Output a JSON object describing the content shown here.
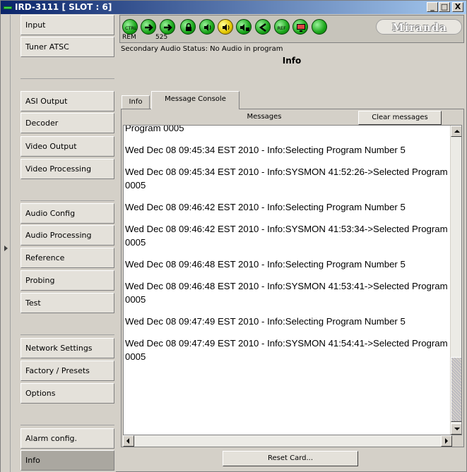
{
  "window": {
    "title": "IRD-3111 [ SLOT : 6]",
    "controls": {
      "minimize": "_",
      "maximize": "□",
      "close": "X"
    }
  },
  "sidebar": {
    "items": [
      {
        "label": "Input"
      },
      {
        "label": "Tuner ATSC"
      },
      {
        "label": "ASI Output"
      },
      {
        "label": "Decoder"
      },
      {
        "label": "Video Output"
      },
      {
        "label": "Video Processing"
      },
      {
        "label": "Audio Config"
      },
      {
        "label": "Audio Processing"
      },
      {
        "label": "Reference"
      },
      {
        "label": "Probing"
      },
      {
        "label": "Test"
      },
      {
        "label": "Network Settings"
      },
      {
        "label": "Factory / Presets"
      },
      {
        "label": "Options"
      },
      {
        "label": "Alarm config."
      },
      {
        "label": "Info"
      }
    ],
    "selected": "Info"
  },
  "toolbar": {
    "icons": [
      {
        "name": "ctrl-icon",
        "text": "CTRL",
        "label": "REM"
      },
      {
        "name": "arrow-right-icon",
        "label": "525"
      },
      {
        "name": "arrow-right-icon-2"
      },
      {
        "name": "lock-icon"
      },
      {
        "name": "audio-icon"
      },
      {
        "name": "audio-yellow-icon"
      },
      {
        "name": "audio-lock-icon"
      },
      {
        "name": "less-than-icon"
      },
      {
        "name": "ref-icon",
        "text": "REF"
      },
      {
        "name": "monitor-icon"
      },
      {
        "name": "status-light-icon"
      }
    ],
    "logo": "Miranda"
  },
  "status": {
    "secondary_audio": "Secondary Audio Status: No Audio in program"
  },
  "panel": {
    "title": "Info",
    "tabs": [
      {
        "label": "Info"
      },
      {
        "label": "Message Console"
      }
    ],
    "active_tab": "Message Console"
  },
  "console": {
    "header": "Messages",
    "clear_label": "Clear messages",
    "entries": [
      "Program 0005",
      "Wed Dec 08 09:45:34 EST 2010 - Info:Selecting Program Number 5",
      "Wed Dec 08 09:45:34 EST 2010 - Info:SYSMON 41:52:26->Selected Program 0005",
      "Wed Dec 08 09:46:42 EST 2010 - Info:Selecting Program Number 5",
      "Wed Dec 08 09:46:42 EST 2010 - Info:SYSMON 41:53:34->Selected Program 0005",
      "Wed Dec 08 09:46:48 EST 2010 - Info:Selecting Program Number 5",
      "Wed Dec 08 09:46:48 EST 2010 - Info:SYSMON 41:53:41->Selected Program 0005",
      "Wed Dec 08 09:47:49 EST 2010 - Info:Selecting Program Number 5",
      "Wed Dec 08 09:47:49 EST 2010 - Info:SYSMON 41:54:41->Selected Program 0005"
    ]
  },
  "footer": {
    "reset_label": "Reset Card..."
  },
  "colors": {
    "title_bar_start": "#0a246a",
    "title_bar_end": "#a6caf0",
    "icon_green": "#1aa61a",
    "selected_nav": "#aaa7a0"
  }
}
